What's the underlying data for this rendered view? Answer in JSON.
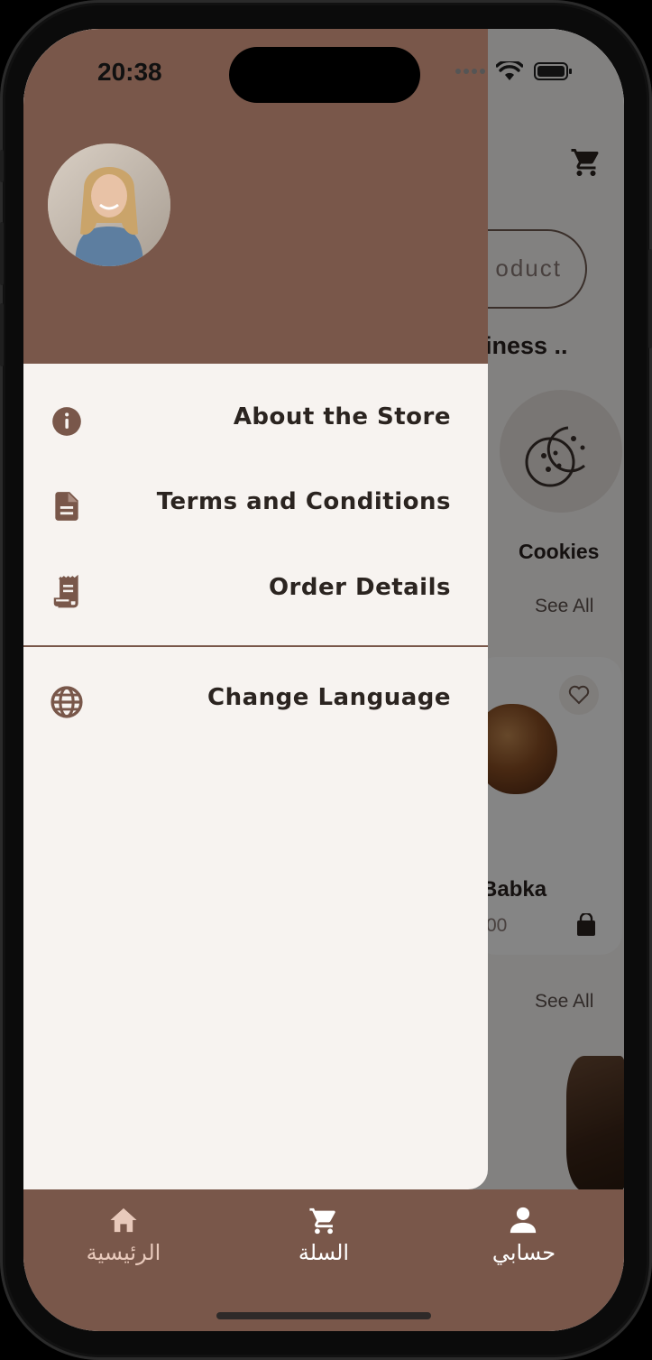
{
  "status_bar": {
    "time": "20:38"
  },
  "background_app": {
    "search_placeholder": "oduct",
    "section_heading": "iness ..",
    "category_label": "Cookies",
    "see_all_1": "See All",
    "see_all_2": "See All",
    "product_name": "e Babka",
    "product_price": "00"
  },
  "drawer": {
    "menu": [
      {
        "label": "About the Store",
        "icon": "info-icon"
      },
      {
        "label": "Terms and Conditions",
        "icon": "document-icon"
      },
      {
        "label": "Order Details",
        "icon": "receipt-icon"
      },
      {
        "label": "Change Language",
        "icon": "globe-icon"
      }
    ]
  },
  "bottom_nav": [
    {
      "label": "الرئيسية",
      "icon": "home-icon"
    },
    {
      "label": "السلة",
      "icon": "cart-icon"
    },
    {
      "label": "حسابي",
      "icon": "person-icon"
    }
  ],
  "colors": {
    "brand_brown": "#79574a",
    "drawer_bg": "#f7f3f0",
    "text_dark": "#2b2420"
  }
}
